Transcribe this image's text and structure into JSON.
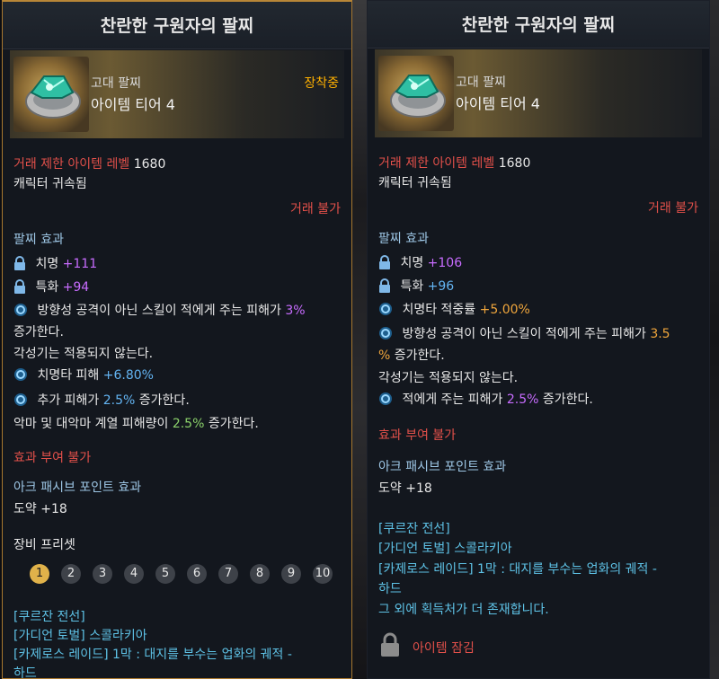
{
  "left": {
    "title": "찬란한 구원자의 팔찌",
    "grade": "고대 팔찌",
    "tier": "아이템 티어 4",
    "equipped": "장착중",
    "trade_level_label": "거래 제한 아이템 레벨",
    "trade_level_value": "1680",
    "bound": "캐릭터 귀속됨",
    "no_trade": "거래 불가",
    "effect_header": "팔찌 효과",
    "stat1_label": "치명",
    "stat1_value": "+111",
    "stat2_label": "특화",
    "stat2_value": "+94",
    "effect1_a": "방향성 공격이 아닌 스킬이 적에게 주는 피해가",
    "effect1_value": "3%",
    "effect1_b": "증가한다.",
    "effect1_c": "각성기는 적용되지 않는다.",
    "effect2_label": "치명타 피해",
    "effect2_value": "+6.80%",
    "effect3_a": "추가 피해가",
    "effect3_value": "2.5%",
    "effect3_b": "증가한다.",
    "effect4_a": "악마 및 대악마 계열 피해량이",
    "effect4_value": "2.5%",
    "effect4_b": "증가한다.",
    "no_effect": "효과 부여 불가",
    "ark_header": "아크 패시브 포인트 효과",
    "ark_value": "도약 +18",
    "preset_header": "장비 프리셋",
    "presets": [
      "1",
      "2",
      "3",
      "4",
      "5",
      "6",
      "7",
      "8",
      "9",
      "10"
    ],
    "source1": "[쿠르잔 전선]",
    "source2": "[가디언 토벌] 스콜라키아",
    "source3": "[카제로스 레이드] 1막 : 대지를 부수는 업화의 궤적 -",
    "source4": "하드"
  },
  "right": {
    "title": "찬란한 구원자의 팔찌",
    "grade": "고대 팔찌",
    "tier": "아이템 티어 4",
    "trade_level_label": "거래 제한 아이템 레벨",
    "trade_level_value": "1680",
    "bound": "캐릭터 귀속됨",
    "no_trade": "거래 불가",
    "effect_header": "팔찌 효과",
    "stat1_label": "치명",
    "stat1_value": "+106",
    "stat2_label": "특화",
    "stat2_value": "+96",
    "effect1_label": "치명타 적중률",
    "effect1_value": "+5.00%",
    "effect2_a": "방향성 공격이 아닌 스킬이 적에게 주는 피해가",
    "effect2_value_a": "3.5",
    "effect2_value_b": "%",
    "effect2_b": "증가한다.",
    "effect2_c": "각성기는 적용되지 않는다.",
    "effect3_a": "적에게 주는 피해가",
    "effect3_value": "2.5%",
    "effect3_b": "증가한다.",
    "no_effect": "효과 부여 불가",
    "ark_header": "아크 패시브 포인트 효과",
    "ark_value": "도약 +18",
    "source1": "[쿠르잔 전선]",
    "source2": "[가디언 토벌] 스콜라키아",
    "source3": "[카제로스 레이드] 1막 : 대지를 부수는 업화의 궤적 -",
    "source4": "하드",
    "more_sources": "그 외에 획득처가 더 존재합니다.",
    "locked": "아이템 잠김"
  }
}
